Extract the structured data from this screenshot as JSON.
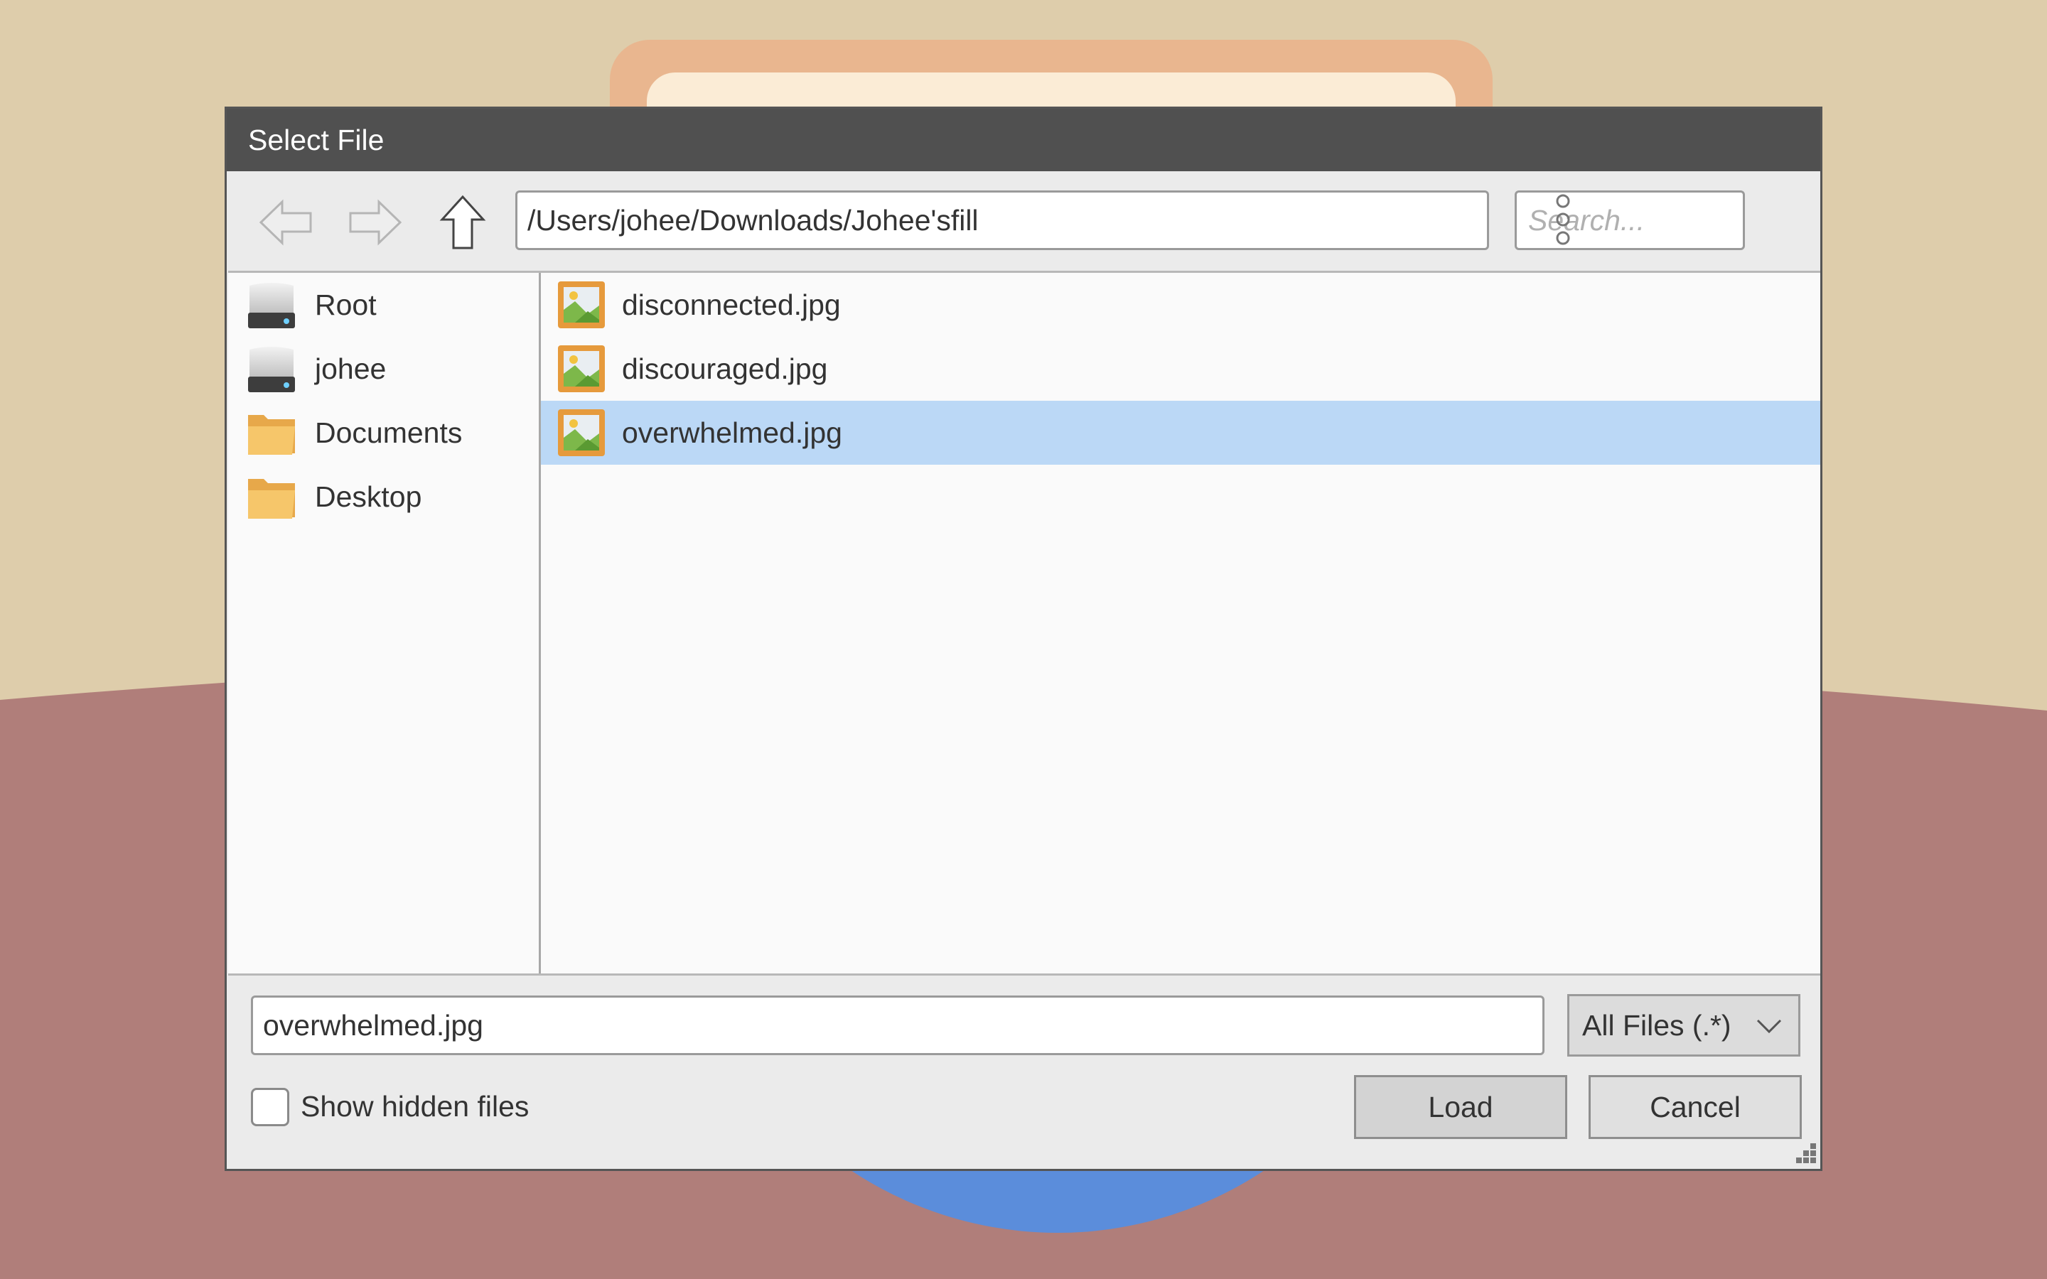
{
  "dialog": {
    "title": "Select File",
    "path": "/Users/johee/Downloads/Johee'sfill",
    "search_placeholder": "Search...",
    "places": [
      {
        "label": "Root",
        "icon": "drive-icon"
      },
      {
        "label": "johee",
        "icon": "drive-icon"
      },
      {
        "label": "Documents",
        "icon": "folder-icon"
      },
      {
        "label": "Desktop",
        "icon": "folder-icon"
      }
    ],
    "files": [
      {
        "name": "disconnected.jpg",
        "icon": "image-file-icon",
        "selected": false
      },
      {
        "name": "discouraged.jpg",
        "icon": "image-file-icon",
        "selected": false
      },
      {
        "name": "overwhelmed.jpg",
        "icon": "image-file-icon",
        "selected": true
      }
    ],
    "filename": "overwhelmed.jpg",
    "filter": "All Files (.*)",
    "show_hidden_label": "Show hidden files",
    "show_hidden_checked": false,
    "load_label": "Load",
    "cancel_label": "Cancel"
  },
  "colors": {
    "titlebar": "#505050",
    "selection": "#bbd8f6",
    "background_top": "#decdab",
    "background_bottom": "#b07e7a",
    "accent_circle": "#5b8ddb"
  }
}
